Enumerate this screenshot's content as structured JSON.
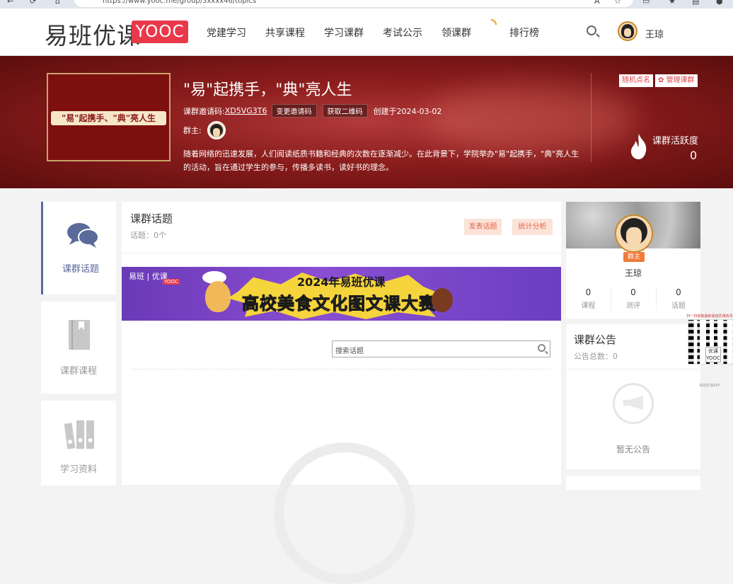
{
  "browser": {
    "url": "https://www.yooc.me/group/3xxxx46/topics"
  },
  "header": {
    "logo_cn": "易班优课",
    "logo_en": "YOOC",
    "menu": [
      "党建学习",
      "共享课程",
      "学习课群",
      "考试公示",
      "领课群",
      "排行榜"
    ],
    "user_name": "王琼"
  },
  "group": {
    "cover_text": "\"易\"起携手、\"典\"亮人生",
    "title": "\"易\"起携手，\"典\"亮人生",
    "invite_label": "课群邀请码:",
    "invite_code": "XD5VG3T6",
    "change_code_btn": "变更邀请码",
    "qr_btn": "获取二维码",
    "created": "创建于2024-03-02",
    "owner_label": "群主:",
    "description": "随着网络的迅速发展，人们阅读纸质书籍和经典的次数在逐渐减少。在此背景下，学院举办\"易\"起携手，\"典\"亮人生的活动，旨在通过学生的参与，传播多读书，读好书的理念。",
    "random_roll_btn": "随机点名",
    "manage_btn": "管理课群",
    "activity_label": "课群活跃度",
    "activity_value": "0"
  },
  "left_nav": [
    {
      "label": "课群话题",
      "icon": "chat-bubbles-icon",
      "active": true
    },
    {
      "label": "课群课程",
      "icon": "book-icon",
      "active": false
    },
    {
      "label": "学习资料",
      "icon": "binders-icon",
      "active": false
    }
  ],
  "main": {
    "title": "课群话题",
    "count": "话题：0个",
    "post_btn": "发表话题",
    "stats_btn": "统计分析",
    "promo_line1": "2024年易班优课",
    "promo_line2": "高校美食文化图文课大赛",
    "promo_logo": "易班 | 优课",
    "promo_logo_sub": "YOOC",
    "search_placeholder": "搜索话题"
  },
  "profile": {
    "badge": "群主",
    "name": "王琼",
    "stats": [
      {
        "value": "0",
        "label": "课程"
      },
      {
        "value": "0",
        "label": "测评"
      },
      {
        "value": "0",
        "label": "话题"
      }
    ]
  },
  "notice": {
    "title": "课群公告",
    "count": "公告总数：0",
    "empty": "暂无公告"
  },
  "qr": {
    "top_text": "扫一扫获取最新易班优课资讯",
    "center_text": "优课 YOOC",
    "bottom_text": "易班优课APP"
  },
  "colors": {
    "brand_red": "#e8394a",
    "banner_dark": "#5c0d0d",
    "nav_active": "#5a6a9a",
    "btn_peach": "#fbe3d8"
  }
}
